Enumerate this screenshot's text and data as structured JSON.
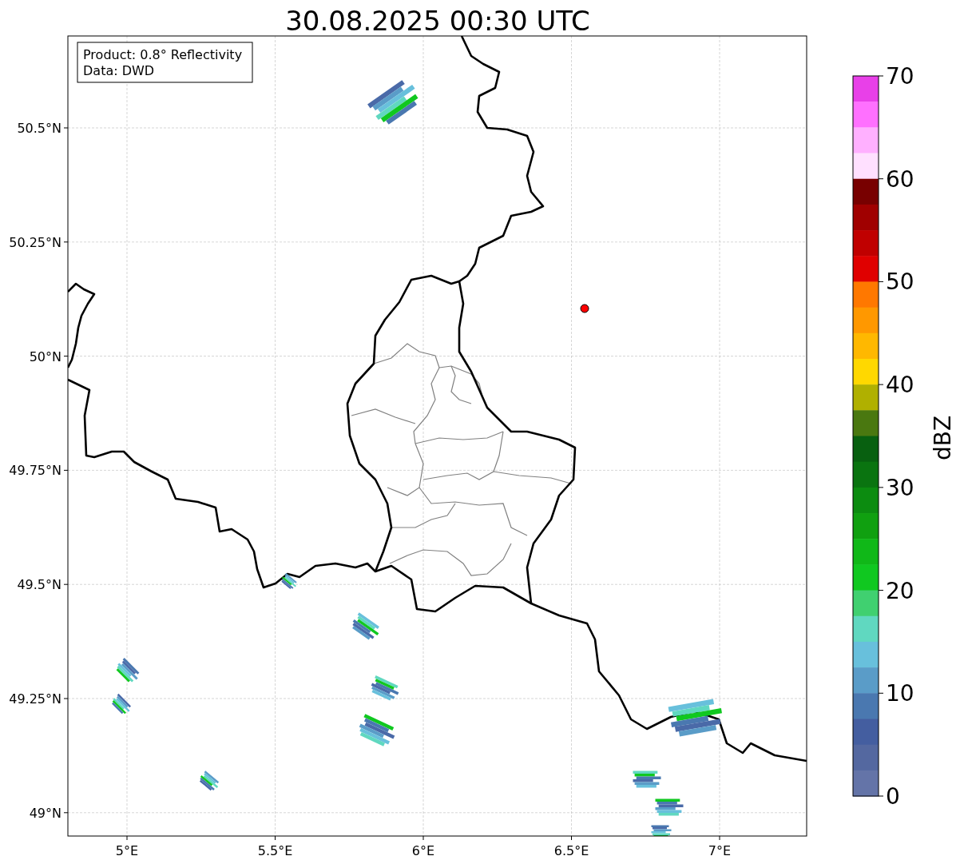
{
  "title": "30.08.2025 00:30 UTC",
  "info_box": [
    "Product: 0.8° Reflectivity",
    "Data: DWD"
  ],
  "lat_ticks": [
    "50.5°N",
    "50.25°N",
    "50°N",
    "49.75°N",
    "49.5°N",
    "49.25°N",
    "49°N"
  ],
  "lon_ticks": [
    "5°E",
    "5.5°E",
    "6°E",
    "6.5°E",
    "7°E"
  ],
  "colorbar": {
    "label": "dBZ",
    "ticks": [
      "70",
      "60",
      "50",
      "40",
      "30",
      "20",
      "10",
      "0"
    ],
    "bands": [
      {
        "color": "#e840e8"
      },
      {
        "color": "#ff70ff"
      },
      {
        "color": "#ffb0ff"
      },
      {
        "color": "#ffe0ff"
      },
      {
        "color": "#780000"
      },
      {
        "color": "#a00000"
      },
      {
        "color": "#c00000"
      },
      {
        "color": "#e00000"
      },
      {
        "color": "#ff7800"
      },
      {
        "color": "#ff9800"
      },
      {
        "color": "#ffb800"
      },
      {
        "color": "#ffd800"
      },
      {
        "color": "#b0b000"
      },
      {
        "color": "#4a7810"
      },
      {
        "color": "#086010"
      },
      {
        "color": "#0a7410"
      },
      {
        "color": "#0c8c10"
      },
      {
        "color": "#10a010"
      },
      {
        "color": "#10b818"
      },
      {
        "color": "#10c820"
      },
      {
        "color": "#40d070"
      },
      {
        "color": "#60d8c0"
      },
      {
        "color": "#68c0dc"
      },
      {
        "color": "#5a9cc8"
      },
      {
        "color": "#4a78b0"
      },
      {
        "color": "#445ea0"
      },
      {
        "color": "#5468a0"
      },
      {
        "color": "#6474a8"
      }
    ]
  }
}
